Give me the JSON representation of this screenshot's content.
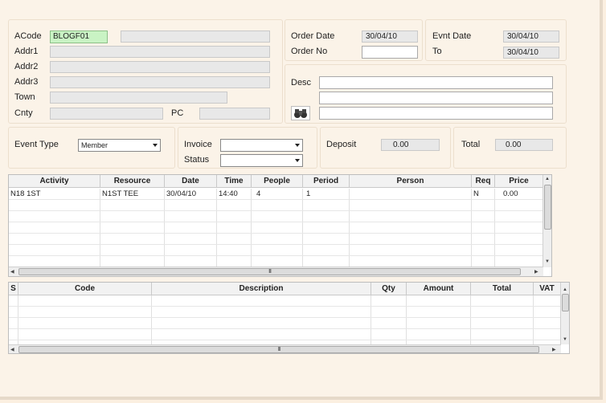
{
  "customer": {
    "acode_label": "ACode",
    "acode_value": "BLOGF01",
    "addr1_label": "Addr1",
    "addr2_label": "Addr2",
    "addr3_label": "Addr3",
    "town_label": "Town",
    "cnty_label": "Cnty",
    "pc_label": "PC"
  },
  "order": {
    "order_date_label": "Order Date",
    "order_date_value": "30/04/10",
    "order_no_label": "Order No",
    "order_no_value": ""
  },
  "event": {
    "evnt_date_label": "Evnt Date",
    "evnt_date_value": "30/04/10",
    "to_label": "To",
    "to_value": "30/04/10"
  },
  "desc": {
    "label": "Desc",
    "icon": "binoculars-icon"
  },
  "event_type": {
    "label": "Event Type",
    "value": "Member"
  },
  "invoice": {
    "invoice_label": "Invoice",
    "invoice_value": "",
    "status_label": "Status",
    "status_value": ""
  },
  "deposit": {
    "label": "Deposit",
    "value": "0.00"
  },
  "total": {
    "label": "Total",
    "value": "0.00"
  },
  "activity_grid": {
    "headers": [
      "Activity",
      "Resource",
      "Date",
      "Time",
      "People",
      "Period",
      "Person",
      "Req",
      "Price"
    ],
    "row": [
      "N18 1ST",
      "N1ST TEE",
      "30/04/10",
      "14:40",
      "4",
      "1",
      "",
      "N",
      "0.00"
    ],
    "scroll_grip": "III"
  },
  "items_grid": {
    "headers": [
      "S",
      "Code",
      "Description",
      "Qty",
      "Amount",
      "Total",
      "VAT"
    ],
    "scroll_grip": "III"
  }
}
